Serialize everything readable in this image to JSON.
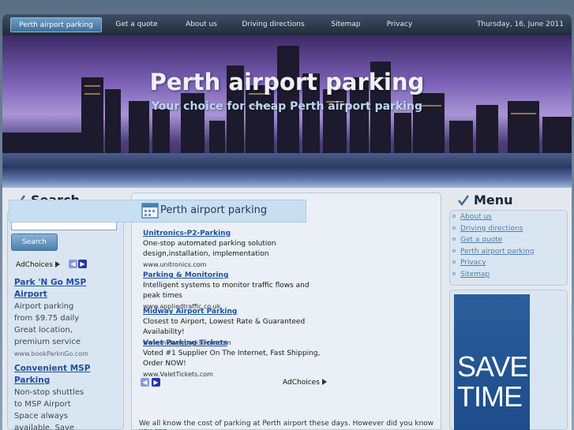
{
  "nav": {
    "items": [
      "Perth airport parking",
      "Get a quote",
      "About us",
      "Driving directions",
      "Sitemap",
      "Privacy"
    ],
    "date": "Thursday, 16, June 2011"
  },
  "banner": {
    "title": "Perth airport parking",
    "tagline": "Your choice for cheap Perth airport parking"
  },
  "search": {
    "title": "Search",
    "button": "Search",
    "adchoices": "AdChoices"
  },
  "left_ads": [
    {
      "title": "Park 'N Go MSP Airport",
      "body": "Airport parking from $9.75 daily Great location, premium service",
      "url": "www.bookParknGo.com"
    },
    {
      "title": "Convenient MSP Parking",
      "body": "Non-stop shuttles to MSP Airport Space always available. Save",
      "url": ""
    }
  ],
  "center": {
    "title": "Perth airport parking",
    "ads": [
      {
        "title": "Unitronics-P2-Parking",
        "body": "One-stop automated parking solution design,installation, implementation",
        "url": "www.unitronics.com"
      },
      {
        "title": "Parking & Monitoring",
        "body": "Intelligent systems to monitor traffic flows and peak times",
        "url": "www.appliedtraffic.co.uk"
      },
      {
        "title": "Midway Airport Parking",
        "body": "Closest to Airport, Lowest Rate & Guaranteed Availability!",
        "url": "www.midwayparksaver.com"
      },
      {
        "title": "Valet Parking Tickets",
        "body": "Voted #1 Supplier On The Internet, Fast Shipping, Order NOW!",
        "url": "www.ValetTickets.com"
      }
    ],
    "adchoices": "AdChoices",
    "intro": "We all know the cost of parking at Perth airport these days. However did you know you can"
  },
  "menu": {
    "title": "Menu",
    "items": [
      "About us",
      "Driving directions",
      "Get a quote",
      "Perth airport parking",
      "Privacy",
      "Sitemap"
    ]
  },
  "save_ad": {
    "line1": "SAVE",
    "line2": "TIME"
  },
  "colors": {
    "accent": "#3f6f9c",
    "link": "#1f4fa5",
    "menu_link": "#4a7db0"
  }
}
